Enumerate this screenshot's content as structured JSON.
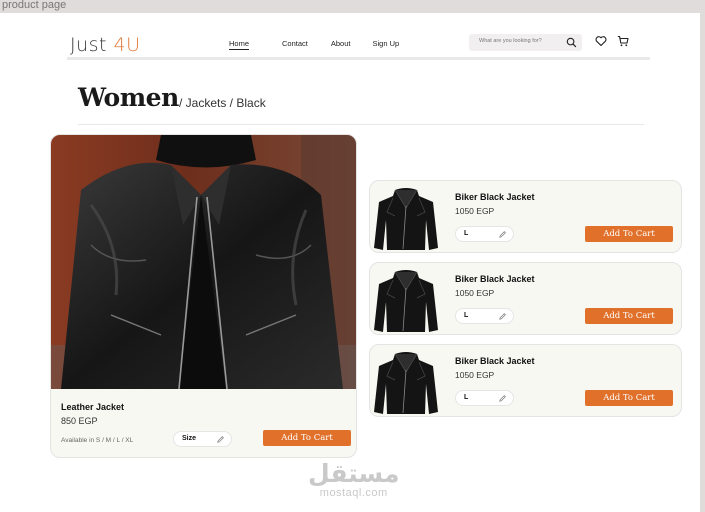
{
  "frame": {
    "label": "product page"
  },
  "header": {
    "logo_main": "Just ",
    "logo_accent": "4U",
    "nav": [
      {
        "label": "Home",
        "active": true
      },
      {
        "label": "Contact",
        "active": false
      },
      {
        "label": "About",
        "active": false
      },
      {
        "label": "Sign Up",
        "active": false
      }
    ],
    "search_placeholder": "What are you looking for?",
    "icons": [
      "search-icon",
      "heart-icon",
      "cart-icon"
    ]
  },
  "page": {
    "title": "Women",
    "breadcrumb": "/ Jackets / Black"
  },
  "featured": {
    "name": "Leather Jacket",
    "price": "850 EGP",
    "availability": "Available in S / M / L / XL",
    "size_label": "Size",
    "cta": "Add To Cart"
  },
  "items": [
    {
      "name": "Biker Black Jacket",
      "price": "1050 EGP",
      "size": "L",
      "cta": "Add To Cart"
    },
    {
      "name": "Biker Black Jacket",
      "price": "1050 EGP",
      "size": "L",
      "cta": "Add To Cart"
    },
    {
      "name": "Biker Black Jacket",
      "price": "1050 EGP",
      "size": "L",
      "cta": "Add To Cart"
    }
  ],
  "colors": {
    "accent": "#e0702a",
    "card_bg": "#f8f8f2",
    "logo_accent": "#e07a3a"
  },
  "watermark": {
    "arabic": "مستقل",
    "latin": "mostaql.com"
  }
}
